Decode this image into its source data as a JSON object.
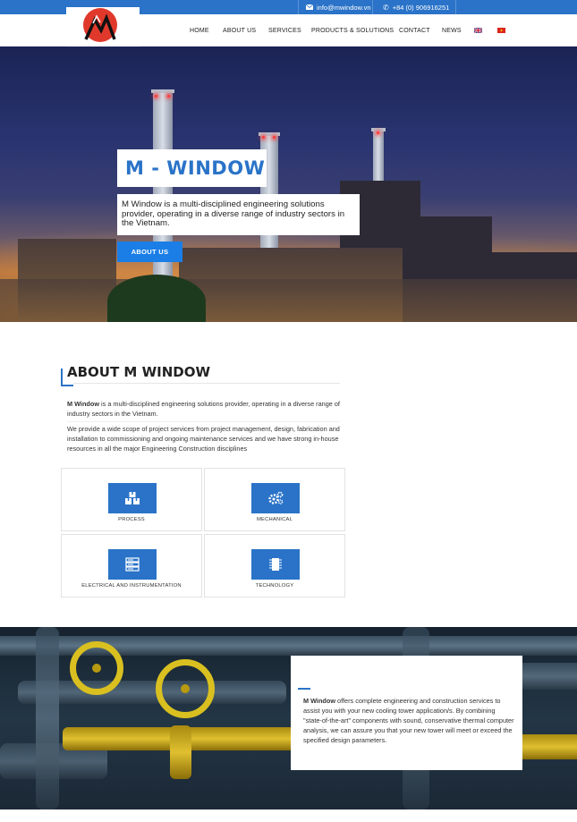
{
  "topbar": {
    "email": "info@mwindow.vn",
    "phone": "+84 (0) 906916251"
  },
  "nav": {
    "items": [
      "HOME",
      "ABOUT US",
      "SERVICES",
      "PRODUCTS & SOLUTIONS",
      "CONTACT",
      "NEWS"
    ]
  },
  "hero": {
    "title": "M - WINDOW",
    "description": "M Window is a multi-disciplined engineering solutions provider, operating in a diverse range of industry sectors in the Vietnam.",
    "button_label": "ABOUT US"
  },
  "about": {
    "title": "ABOUT M WINDOW",
    "p1_bold": "M Window",
    "p1_rest": " is a multi-disciplined engineering solutions provider, operating in a diverse range of industry sectors in the Vietnam.",
    "p2": "We provide a wide scope of project services from project management, design, fabrication and installation to commissioning and ongoing maintenance services and we have strong in-house resources in all the major Engineering Construction disciplines",
    "cards": [
      {
        "label": "PROCESS",
        "icon": "boxes-icon"
      },
      {
        "label": "MECHANICAL",
        "icon": "gears-icon"
      },
      {
        "label": "ELECTRICAL AND INSTRUMENTATION",
        "icon": "server-icon"
      },
      {
        "label": "TECHNOLOGY",
        "icon": "chip-icon"
      }
    ]
  },
  "bottom": {
    "bold": "M Window",
    "text": " offers complete engineering and construction services to assist you with your new cooling tower application/s. By combining \"state-of-the-art\" components with sound, conservative thermal computer analysis, we can assure you that your new tower will meet or exceed the specified design parameters."
  },
  "colors": {
    "brand_blue": "#2a73c8",
    "button_blue": "#1a7ee6"
  }
}
